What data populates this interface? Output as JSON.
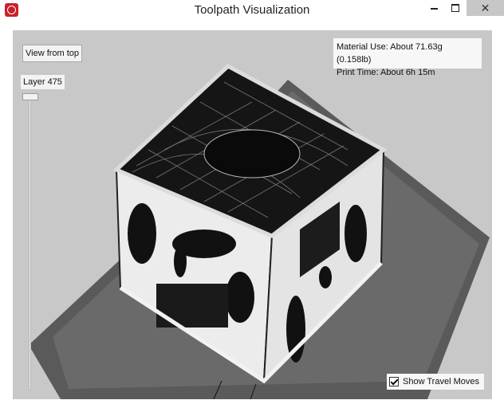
{
  "window": {
    "title": "Toolpath Visualization",
    "minimize_icon": "minimize-icon",
    "maximize_icon": "maximize-icon",
    "close_icon": "close-icon",
    "close_glyph": "✕",
    "app_icon": "app-logo-icon",
    "app_icon_color": "#c9202a"
  },
  "viewport": {
    "view_from_top_label": "View from top",
    "layer_label": "Layer 475",
    "layer_slider_fraction": 0.02,
    "material_use": "Material Use: About 71.63g (0.158lb)",
    "print_time": "Print Time: About 6h 15m",
    "show_travel_label": "Show Travel Moves",
    "show_travel_checked": true,
    "background_color": "#c8c8c8",
    "build_plate_color": "#595959"
  }
}
